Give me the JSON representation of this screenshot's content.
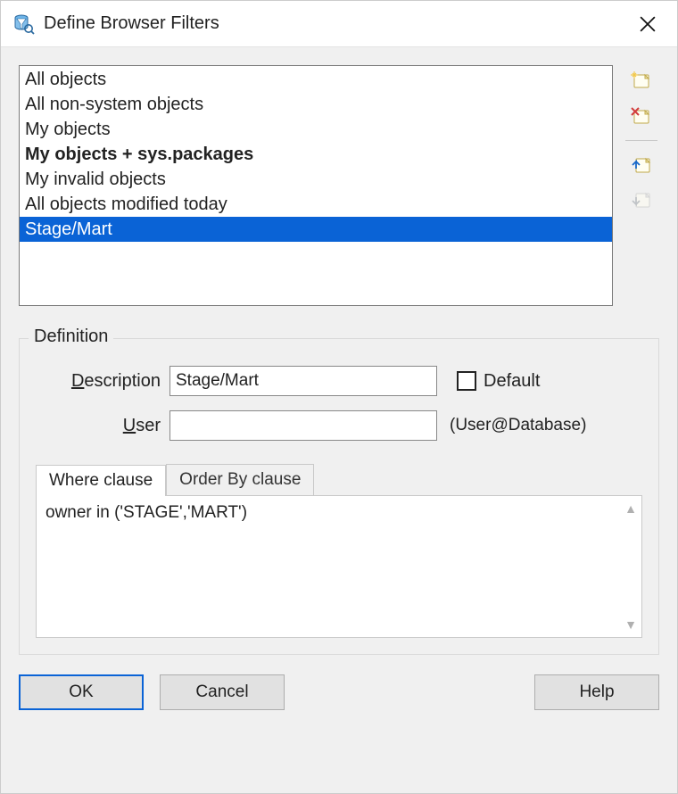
{
  "window": {
    "title": "Define Browser Filters"
  },
  "filters": {
    "items": [
      {
        "label": "All objects",
        "bold": false,
        "selected": false
      },
      {
        "label": "All non-system objects",
        "bold": false,
        "selected": false
      },
      {
        "label": "My objects",
        "bold": false,
        "selected": false
      },
      {
        "label": "My objects + sys.packages",
        "bold": true,
        "selected": false
      },
      {
        "label": "My invalid objects",
        "bold": false,
        "selected": false
      },
      {
        "label": "All objects modified today",
        "bold": false,
        "selected": false
      },
      {
        "label": "Stage/Mart",
        "bold": false,
        "selected": true
      }
    ]
  },
  "toolbar": {
    "new_name": "new-filter-button",
    "delete_name": "delete-filter-button",
    "move_up_name": "move-up-button",
    "move_down_name": "move-down-button",
    "move_down_disabled": true
  },
  "definition": {
    "group_label": "Definition",
    "description_label": "Description",
    "description_value": "Stage/Mart",
    "default_label": "Default",
    "default_checked": false,
    "user_label": "User",
    "user_value": "",
    "user_hint": "(User@Database)",
    "tabs": {
      "where_label": "Where clause",
      "orderby_label": "Order By clause",
      "active": "where",
      "where_text": "owner in ('STAGE','MART')",
      "orderby_text": ""
    }
  },
  "buttons": {
    "ok": "OK",
    "cancel": "Cancel",
    "help": "Help"
  }
}
